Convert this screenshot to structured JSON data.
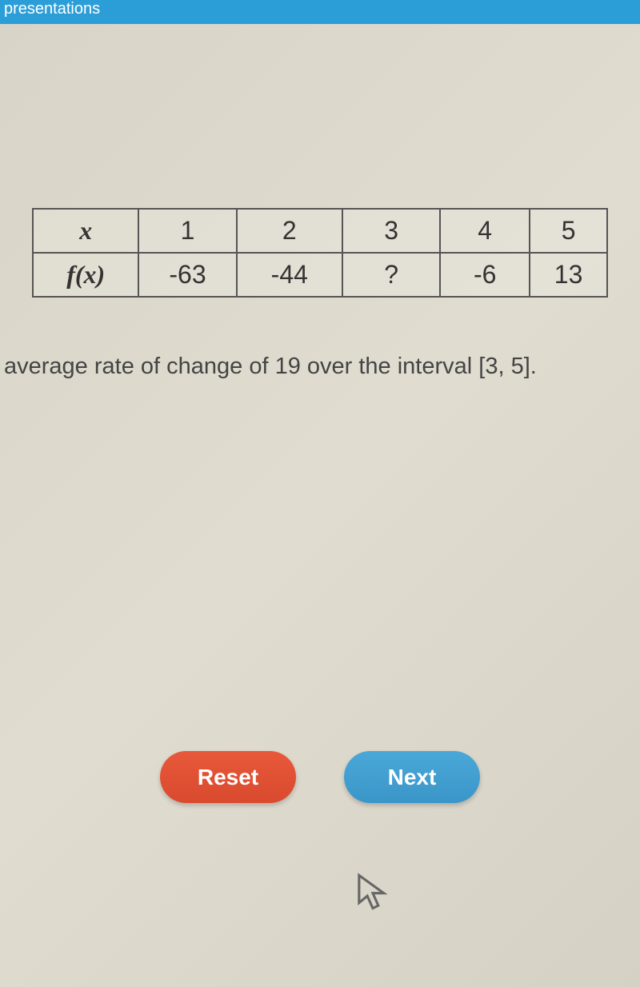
{
  "header": {
    "title_fragment": "presentations"
  },
  "table": {
    "row1": {
      "label": "x",
      "c1": "1",
      "c2": "2",
      "c3": "3",
      "c4": "4",
      "c5": "5"
    },
    "row2": {
      "label": "f(x)",
      "c1": "-63",
      "c2": "-44",
      "c3": "?",
      "c4": "-6",
      "c5": "13"
    }
  },
  "question": "average rate of change of 19 over the interval [3, 5].",
  "buttons": {
    "reset": "Reset",
    "next": "Next"
  }
}
